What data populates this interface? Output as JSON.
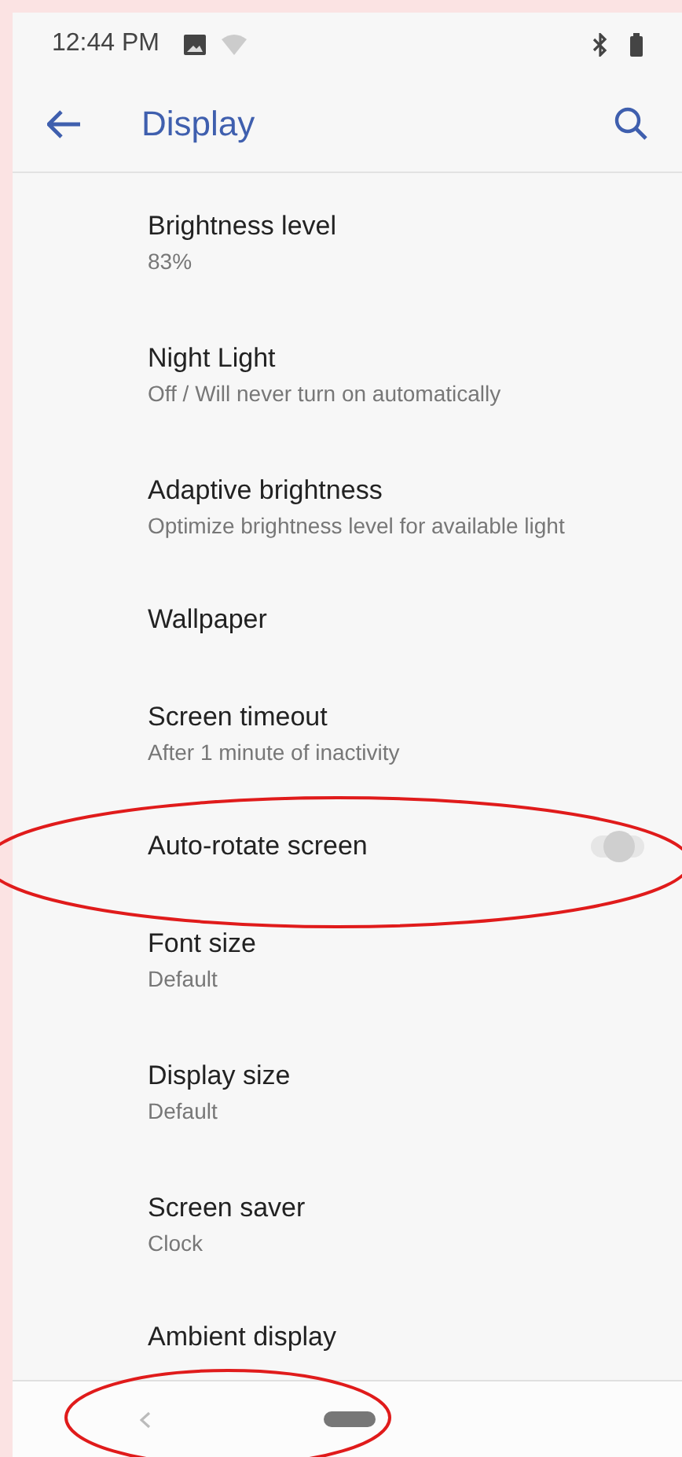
{
  "status_bar": {
    "time": "12:44 PM"
  },
  "toolbar": {
    "title": "Display"
  },
  "settings": [
    {
      "kind": "text",
      "title": "Brightness level",
      "summary": "83%"
    },
    {
      "kind": "text",
      "title": "Night Light",
      "summary": "Off / Will never turn on automatically"
    },
    {
      "kind": "text",
      "title": "Adaptive brightness",
      "summary": "Optimize brightness level for available light"
    },
    {
      "kind": "text",
      "title": "Wallpaper"
    },
    {
      "kind": "text",
      "title": "Screen timeout",
      "summary": "After 1 minute of inactivity"
    },
    {
      "kind": "toggle",
      "title": "Auto-rotate screen",
      "on": false
    },
    {
      "kind": "text",
      "title": "Font size",
      "summary": "Default"
    },
    {
      "kind": "text",
      "title": "Display size",
      "summary": "Default"
    },
    {
      "kind": "text",
      "title": "Screen saver",
      "summary": "Clock"
    },
    {
      "kind": "text",
      "title": "Ambient display"
    }
  ]
}
